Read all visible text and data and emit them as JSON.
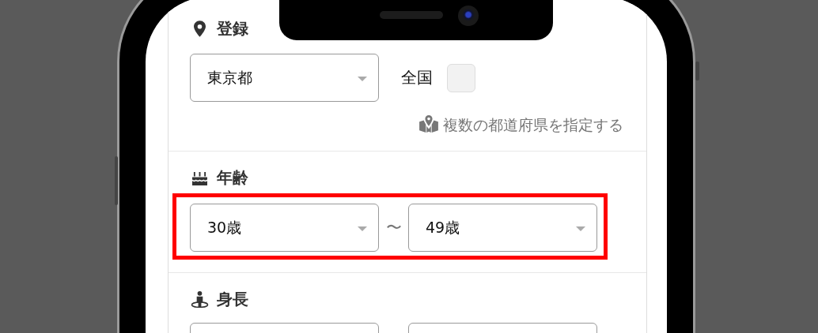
{
  "sections": [
    {
      "kind": "location",
      "heading": "登録",
      "fields": [
        {
          "kind": "select",
          "value": "東京都"
        }
      ],
      "nationwide": {
        "label": "全国",
        "checked": false
      },
      "link": "複数の都道府県を指定する"
    },
    {
      "kind": "range",
      "heading": "年齢",
      "highlighted": true,
      "fields": [
        {
          "kind": "select",
          "value": "30歳"
        },
        {
          "kind": "select",
          "value": "49歳"
        }
      ],
      "separator": "〜"
    },
    {
      "kind": "range",
      "heading": "身長",
      "highlighted": false,
      "fields": [
        {
          "kind": "select"
        },
        {
          "kind": "select"
        }
      ]
    }
  ]
}
